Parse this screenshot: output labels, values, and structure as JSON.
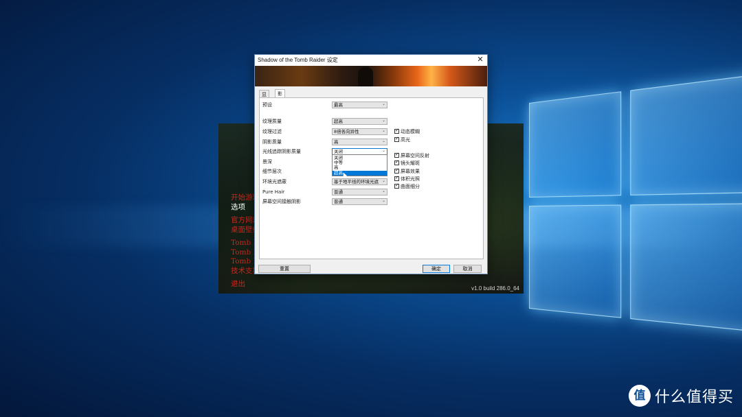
{
  "dialog": {
    "title": "Shadow of the Tomb Raider 设定",
    "close_glyph": "✕",
    "tabs": [
      {
        "label": "显示"
      },
      {
        "label": "影像"
      }
    ],
    "settings": [
      {
        "label": "预设",
        "value": "最高"
      },
      {
        "label": "纹理质量",
        "value": "超高"
      },
      {
        "label": "纹理过滤",
        "value": "8倍各向异性"
      },
      {
        "label": "阴影质量",
        "value": "高"
      },
      {
        "label": "光线追踪阴影质量",
        "value": "关闭"
      },
      {
        "label": "景深",
        "value": ""
      },
      {
        "label": "细节层次",
        "value": ""
      },
      {
        "label": "环境光遮蔽",
        "value": "基于地平线的环境光遮"
      },
      {
        "label": "Pure Hair",
        "value": "普通"
      },
      {
        "label": "屏幕空间接触阴影",
        "value": "普通"
      }
    ],
    "dropdown_options": [
      "关闭",
      "中等",
      "高",
      "超高"
    ],
    "dropdown_highlighted": "超高",
    "checkboxes": [
      {
        "label": "动态模糊",
        "checked": true
      },
      {
        "label": "高光",
        "checked": true
      },
      {
        "label": "屏幕空间反射",
        "checked": true
      },
      {
        "label": "镜头耀斑",
        "checked": true
      },
      {
        "label": "屏幕效果",
        "checked": true
      },
      {
        "label": "体积光照",
        "checked": true
      },
      {
        "label": "曲面细分",
        "checked": true
      }
    ],
    "buttons": {
      "reset": "重置",
      "ok": "确定",
      "cancel": "取消"
    }
  },
  "launcher": {
    "menu": [
      "开始游戏",
      "选项",
      "官方网站",
      "桌面壁纸",
      "Tomb Raider",
      "Tomb Raider",
      "Tomb Raider",
      "技术支持",
      "退出"
    ],
    "build": "v1.0 build 286.0_64"
  },
  "watermark": {
    "text": "什么值得买"
  }
}
